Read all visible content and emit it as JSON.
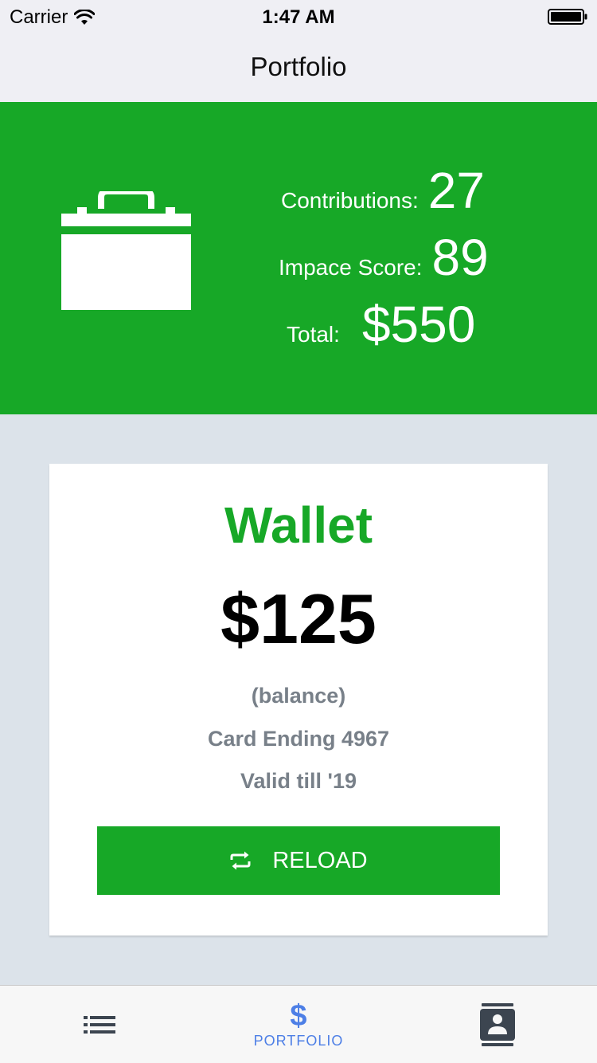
{
  "status_bar": {
    "carrier": "Carrier",
    "time": "1:47 AM",
    "wifi_icon": "wifi-icon",
    "battery_icon": "battery-full-icon"
  },
  "nav": {
    "title": "Portfolio"
  },
  "summary": {
    "icon": "briefcase-icon",
    "contributions_label": "Contributions:",
    "contributions_value": "27",
    "impact_label": "Impace Score:",
    "impact_value": "89",
    "total_label": "Total:",
    "total_value": "$550"
  },
  "wallet": {
    "title": "Wallet",
    "balance": "$125",
    "balance_caption": "(balance)",
    "card_ending": "Card Ending 4967",
    "valid_till": "Valid till '19",
    "reload_label": "RELOAD",
    "reload_icon": "repeat-icon"
  },
  "tab_bar": {
    "tabs": [
      {
        "icon": "list-icon",
        "label": ""
      },
      {
        "icon": "dollar-icon",
        "glyph": "$",
        "label": "PORTFOLIO",
        "active": true
      },
      {
        "icon": "contact-card-icon",
        "label": ""
      }
    ]
  },
  "colors": {
    "brand_green": "#17a827",
    "background": "#dce3ea",
    "active_tab": "#4d7fe6",
    "muted_text": "#788089",
    "tab_icon": "#3c4550"
  }
}
